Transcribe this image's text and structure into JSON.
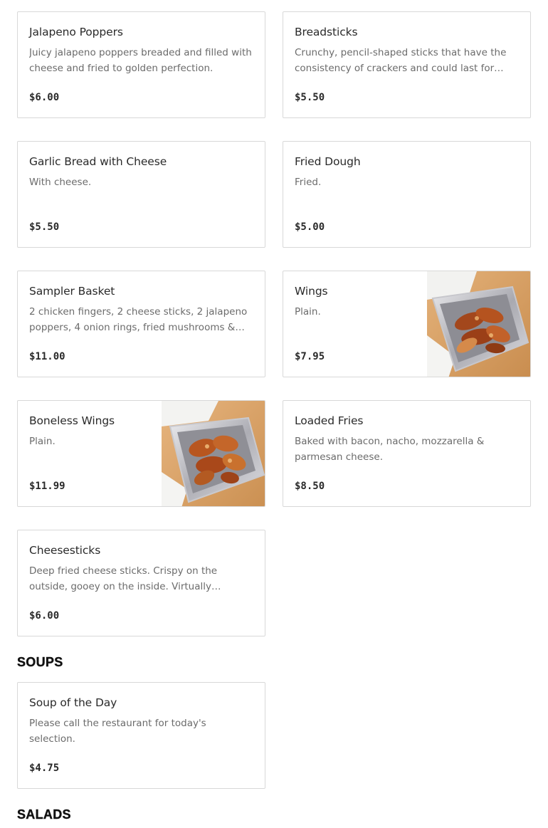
{
  "appetizers": [
    {
      "name": "Jalapeno Poppers",
      "description": "Juicy jalapeno poppers breaded and filled with cheese and fried to golden perfection.",
      "price": "$6.00"
    },
    {
      "name": "Breadsticks",
      "description": "Crunchy, pencil-shaped sticks that have the consistency of crackers and could last for days in an open container.",
      "price": "$5.50"
    },
    {
      "name": "Garlic Bread with Cheese",
      "description": "With cheese.",
      "price": "$5.50"
    },
    {
      "name": "Fried Dough",
      "description": "Fried.",
      "price": "$5.00"
    },
    {
      "name": "Sampler Basket",
      "description": "2 chicken fingers, 2 cheese sticks, 2 jalapeno poppers, 4 onion rings, fried mushrooms & dip.",
      "price": "$11.00"
    },
    {
      "name": "Wings",
      "description": "Plain.",
      "price": "$7.95",
      "image": "wings-photo"
    },
    {
      "name": "Boneless Wings",
      "description": "Plain.",
      "price": "$11.99",
      "image": "boneless-wings-photo"
    },
    {
      "name": "Loaded Fries",
      "description": "Baked with bacon, nacho, mozzarella & parmesan cheese.",
      "price": "$8.50"
    },
    {
      "name": "Cheesesticks",
      "description": "Deep fried cheese sticks. Crispy on the outside, gooey on the inside. Virtually guaranteed to be a hit with everyone.",
      "price": "$6.00"
    }
  ],
  "soups": {
    "heading": "SOUPS",
    "items": [
      {
        "name": "Soup of the Day",
        "description": "Please call the restaurant for today's selection.",
        "price": "$4.75"
      }
    ]
  },
  "salads": {
    "heading": "SALADS"
  }
}
